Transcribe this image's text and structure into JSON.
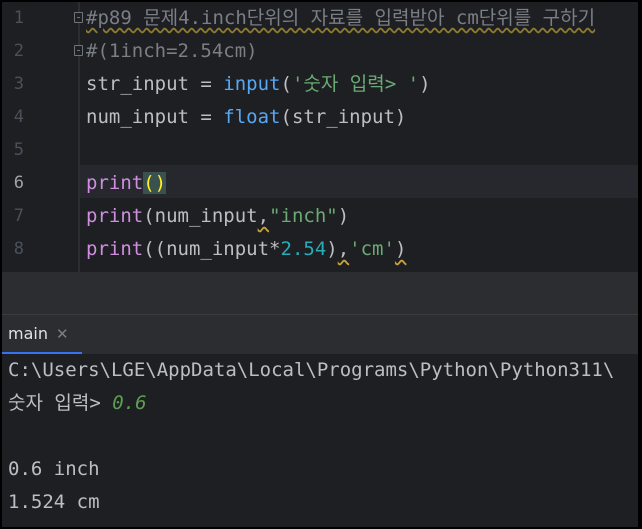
{
  "editor": {
    "line_numbers": [
      "1",
      "2",
      "3",
      "4",
      "5",
      "6",
      "7",
      "8"
    ],
    "line1_comment": "#p89 문제4.inch단위의 자료를 입력받아 cm단위를 구하기",
    "line2_comment": "#(1inch=2.54cm)",
    "line3": {
      "var": "str_input",
      "op": " = ",
      "fn": "input",
      "open": "(",
      "str": "'숫자 입력> '",
      "close": ")"
    },
    "line4": {
      "var": "num_input",
      "op": " = ",
      "fn": "float",
      "open": "(",
      "arg": "str_input",
      "close": ")"
    },
    "line6": {
      "fn": "print",
      "parens": "()"
    },
    "line7": {
      "fn": "print",
      "open": "(",
      "arg": "num_input",
      "comma": ",",
      "str": "\"inch\"",
      "close": ")"
    },
    "line8": {
      "fn": "print",
      "open": "((",
      "arg": "num_input",
      "op": "*",
      "num": "2.54",
      "close1": ")",
      "comma": ",",
      "str": "'cm'",
      "close": ")"
    }
  },
  "run_panel": {
    "tab_label": "main",
    "console_lines": {
      "path": "C:\\Users\\LGE\\AppData\\Local\\Programs\\Python\\Python311\\",
      "prompt": "숫자 입력> ",
      "input_value": "0.6",
      "out1": "0.6 inch",
      "out2": "1.524 cm"
    }
  },
  "colors": {
    "background": "#1e1f22",
    "keyword_print": "#cf8ee0",
    "function": "#56a8f5",
    "string": "#6aab73",
    "number": "#2aacb8",
    "comment": "#7a7e85",
    "user_input": "#5d9f52"
  }
}
